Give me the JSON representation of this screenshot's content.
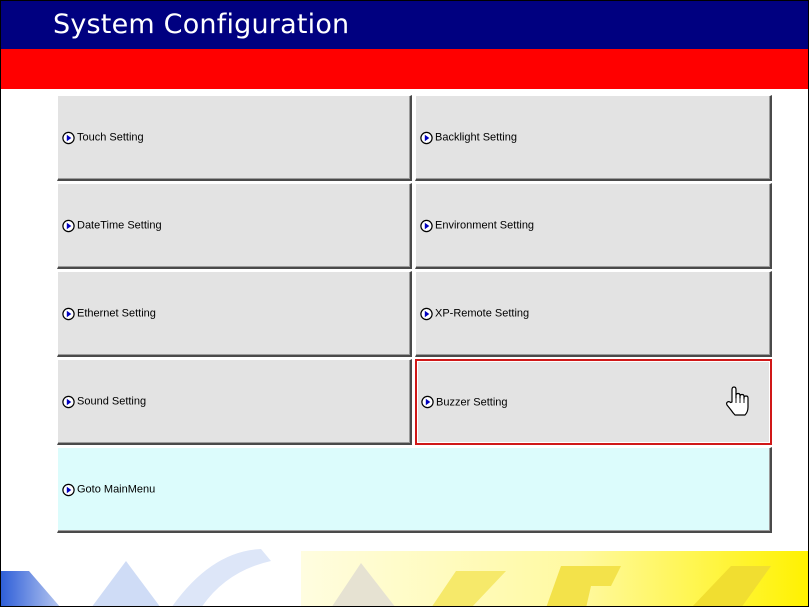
{
  "header": {
    "title": "System Configuration"
  },
  "buttons": {
    "touch": "Touch Setting",
    "backlight": "Backlight Setting",
    "datetime": "DateTime Setting",
    "environment": "Environment Setting",
    "ethernet": "Ethernet Setting",
    "xpremote": "XP-Remote Setting",
    "sound": "Sound Setting",
    "buzzer": "Buzzer Setting",
    "mainmenu": "Goto MainMenu"
  },
  "colors": {
    "title_bar": "#000080",
    "accent_band": "#ff0000",
    "button_face": "#e3e3e3",
    "mainmenu_face": "#dcfcfc",
    "highlight_border": "#d01818"
  },
  "icons": {
    "button_bullet": "right-arrow-circle-icon",
    "cursor": "hand-pointer-icon"
  }
}
